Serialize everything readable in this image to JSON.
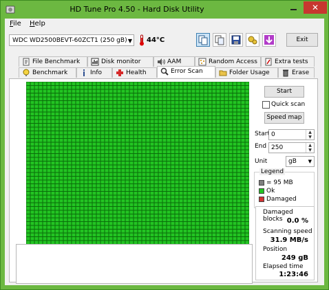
{
  "window": {
    "title": "HD Tune Pro 4.50 - Hard Disk Utility",
    "close_glyph": "✕"
  },
  "menu": [
    {
      "accel": "F",
      "rest": "ile"
    },
    {
      "accel": "H",
      "rest": "elp"
    }
  ],
  "toolbar": {
    "drive": "WDC WD2500BEVT-60ZCT1 (250 gB)",
    "temperature": "44°C",
    "exit_label": "Exit",
    "icons": [
      "copy-text-icon",
      "copy-screenshot-icon",
      "save-icon",
      "options-icon",
      "download-icon"
    ]
  },
  "tabs_row1": [
    {
      "label": "File Benchmark",
      "icon": "file-benchmark-icon"
    },
    {
      "label": "Disk monitor",
      "icon": "disk-monitor-icon"
    },
    {
      "label": "AAM",
      "icon": "speaker-icon"
    },
    {
      "label": "Random Access",
      "icon": "random-access-icon"
    },
    {
      "label": "Extra tests",
      "icon": "extra-tests-icon"
    }
  ],
  "tabs_row2": [
    {
      "label": "Benchmark",
      "icon": "benchmark-icon"
    },
    {
      "label": "Info",
      "icon": "info-icon"
    },
    {
      "label": "Health",
      "icon": "health-cross-icon"
    },
    {
      "label": "Error Scan",
      "icon": "magnifier-icon",
      "active": true
    },
    {
      "label": "Folder Usage",
      "icon": "folder-icon"
    },
    {
      "label": "Erase",
      "icon": "trash-icon"
    }
  ],
  "scan": {
    "status": "complete, no damaged blocks",
    "ok_color": "#22c422",
    "damaged_color": "#d23232",
    "block_color_gray": "#808080"
  },
  "controls": {
    "start_label": "Start",
    "quick_scan_label": "Quick scan",
    "quick_scan_checked": false,
    "speed_map_label": "Speed map",
    "start_field_label": "Start",
    "start_value": "0",
    "end_field_label": "End",
    "end_value": "250",
    "unit_label": "Unit",
    "unit_value": "gB"
  },
  "legend": {
    "title": "Legend",
    "block_size": "= 95 MB",
    "ok": "Ok",
    "damaged": "Damaged"
  },
  "stats": {
    "damaged_blocks_label": "Damaged blocks",
    "damaged_blocks_value": "0.0 %",
    "scanning_speed_label": "Scanning speed",
    "scanning_speed_value": "31.9 MB/s",
    "position_label": "Position",
    "position_value": "249 gB",
    "elapsed_label": "Elapsed time",
    "elapsed_value": "1:23:46"
  }
}
